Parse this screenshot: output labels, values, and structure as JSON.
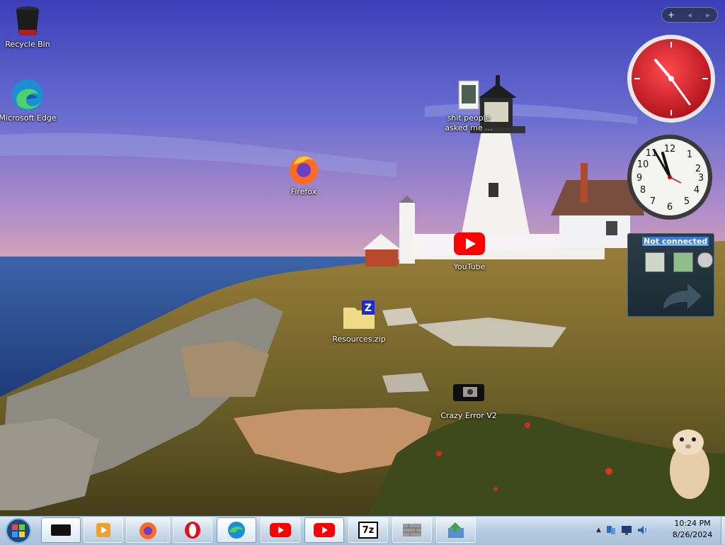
{
  "desktop": {
    "icons": [
      {
        "label": "Recycle Bin",
        "icon": "recycle-bin-icon"
      },
      {
        "label": "Microsoft Edge",
        "icon": "edge-icon"
      },
      {
        "label": "Firefox",
        "icon": "firefox-icon"
      },
      {
        "label": "shit people asked me ...",
        "icon": "folder-icon"
      },
      {
        "label": "YouTube",
        "icon": "youtube-icon"
      },
      {
        "label": "Resources.zip",
        "icon": "zip-folder-icon"
      },
      {
        "label": "Crazy Error V2",
        "icon": "app-icon"
      }
    ]
  },
  "gadgets": {
    "controls": {
      "add": "+",
      "prev": "◂",
      "next": "▸"
    },
    "messenger_status": "Not connected"
  },
  "taskbar": {
    "pinned": [
      "app-icon",
      "media-player-icon",
      "firefox-icon",
      "opera-icon",
      "edge-icon",
      "youtube-icon",
      "youtube-icon",
      "7zip-icon",
      "firewall-icon",
      "installer-icon"
    ],
    "sevenzip_label": "7z",
    "tray": [
      "show-hidden-icons",
      "network-icon",
      "display-icon",
      "volume-icon"
    ],
    "tray_arrow": "▲",
    "time": "10:24 PM",
    "date": "8/26/2024"
  },
  "colors": {
    "taskbar": "#b8cde2",
    "sky_top": "#3a3fb0",
    "sea": "#2e4c8e",
    "clock_red": "#d8242c"
  }
}
